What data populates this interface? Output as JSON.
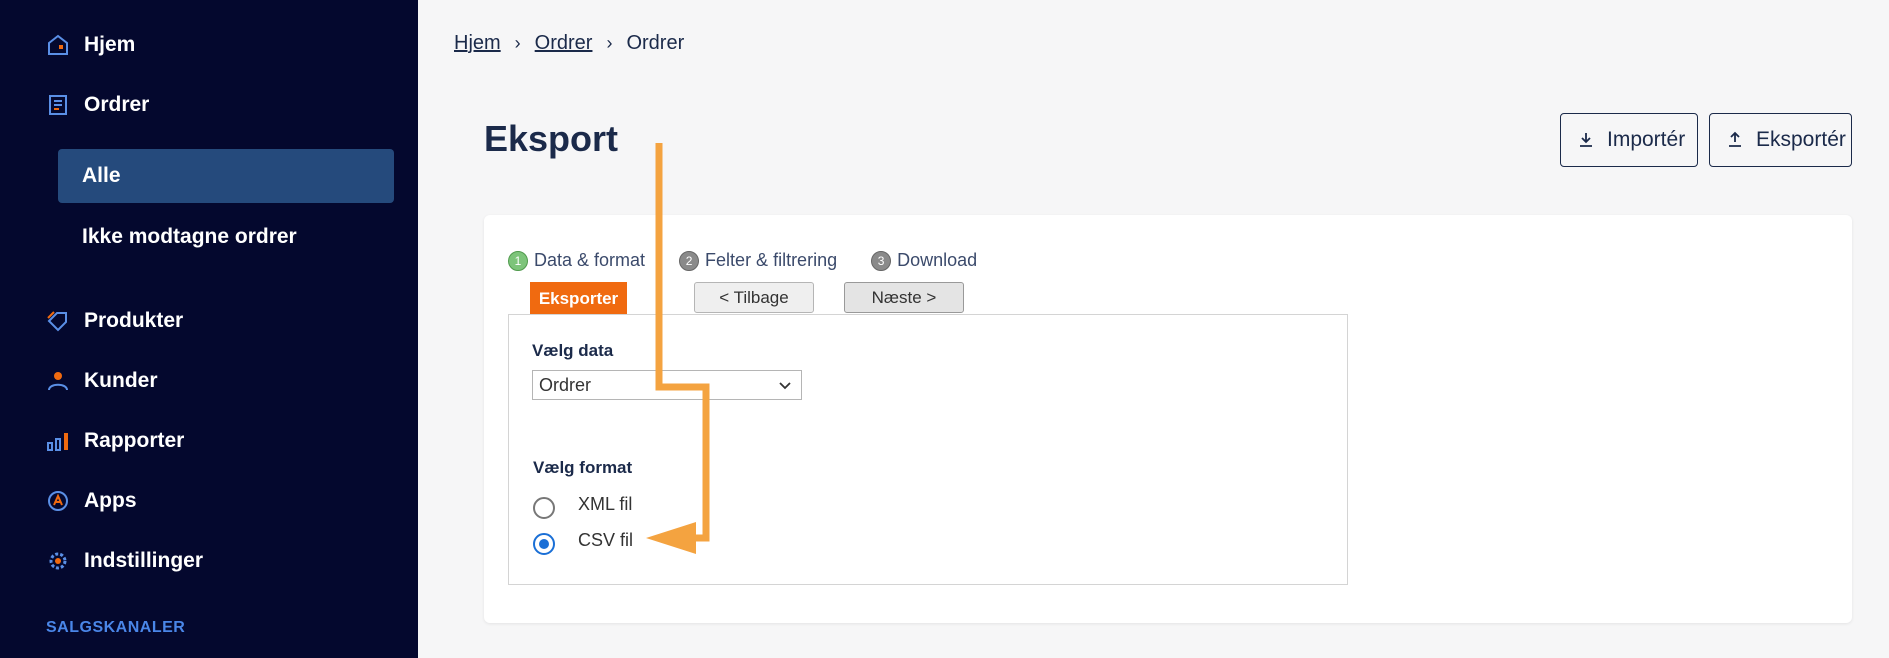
{
  "sidebar": {
    "items": [
      {
        "label": "Hjem",
        "icon": "home-icon"
      },
      {
        "label": "Ordrer",
        "icon": "orders-icon"
      },
      {
        "label": "Produkter",
        "icon": "tag-icon"
      },
      {
        "label": "Kunder",
        "icon": "person-icon"
      },
      {
        "label": "Rapporter",
        "icon": "bar-chart-icon"
      },
      {
        "label": "Apps",
        "icon": "apps-icon"
      },
      {
        "label": "Indstillinger",
        "icon": "gear-icon"
      }
    ],
    "sub_items": [
      {
        "label": "Alle",
        "active": true
      },
      {
        "label": "Ikke modtagne ordrer",
        "active": false
      }
    ],
    "section_title": "SALGSKANALER"
  },
  "breadcrumb": [
    "Hjem",
    "Ordrer",
    "Ordrer"
  ],
  "page_title": "Eksport",
  "header_buttons": {
    "import_label": "Importér",
    "export_label": "Eksportér"
  },
  "steps": [
    {
      "num": "1",
      "label": "Data & format",
      "done": true
    },
    {
      "num": "2",
      "label": "Felter & filtrering",
      "done": false
    },
    {
      "num": "3",
      "label": "Download",
      "done": false
    }
  ],
  "tab_label": "Eksporter",
  "nav": {
    "back_label": "< Tilbage",
    "next_label": "Næste >"
  },
  "form": {
    "data_label": "Vælg data",
    "data_value": "Ordrer",
    "format_label": "Vælg format",
    "options": [
      {
        "label": "XML fil",
        "checked": false
      },
      {
        "label": "CSV fil",
        "checked": true
      }
    ]
  },
  "colors": {
    "sidebar_bg": "#04082e",
    "active_item_bg": "#254a7c",
    "accent_orange": "#f06a10",
    "annotation_arrow": "#f4a340",
    "radio_checked": "#1a6fd6"
  }
}
